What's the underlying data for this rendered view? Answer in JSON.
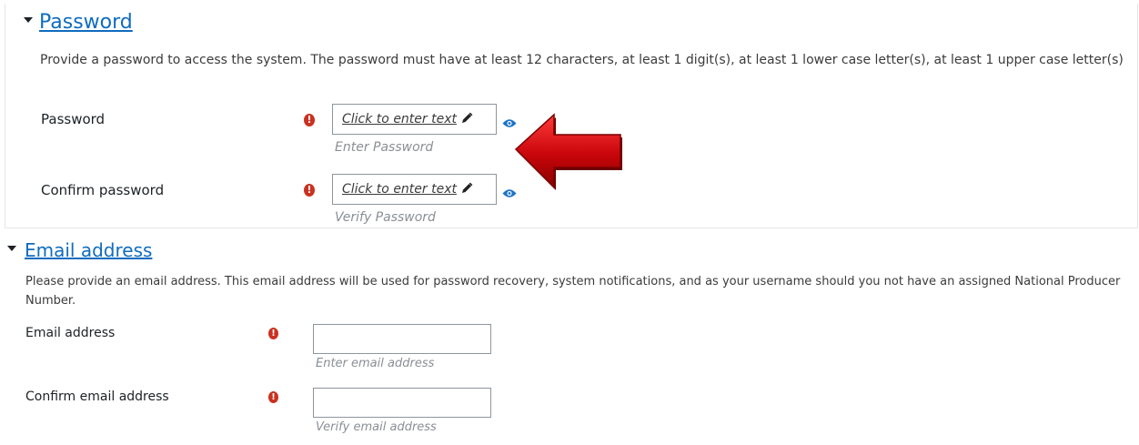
{
  "password_section": {
    "title": "Password",
    "description": "Provide a password to access the system. The password must have at least 12 characters, at least 1 digit(s), at least 1 lower case letter(s), at least 1 upper case letter(s)",
    "fields": [
      {
        "label": "Password",
        "inline_prompt": "Click to enter text",
        "hint": "Enter Password"
      },
      {
        "label": "Confirm password",
        "inline_prompt": "Click to enter text",
        "hint": "Verify Password"
      }
    ]
  },
  "email_section": {
    "title": "Email address",
    "description": "Please provide an email address. This email address will be used for password recovery, system notifications, and as your username should you not have an assigned National Producer Number.",
    "fields": [
      {
        "label": "Email address",
        "value": "",
        "hint": "Enter email address"
      },
      {
        "label": "Confirm email address",
        "value": "",
        "hint": "Verify email address"
      }
    ]
  },
  "required_icon_glyph": "!",
  "colors": {
    "link": "#0f6cbf",
    "required": "#ca3120",
    "arrow": "#c8050a",
    "hint": "#8a8f95",
    "eye": "#1a73c7"
  }
}
